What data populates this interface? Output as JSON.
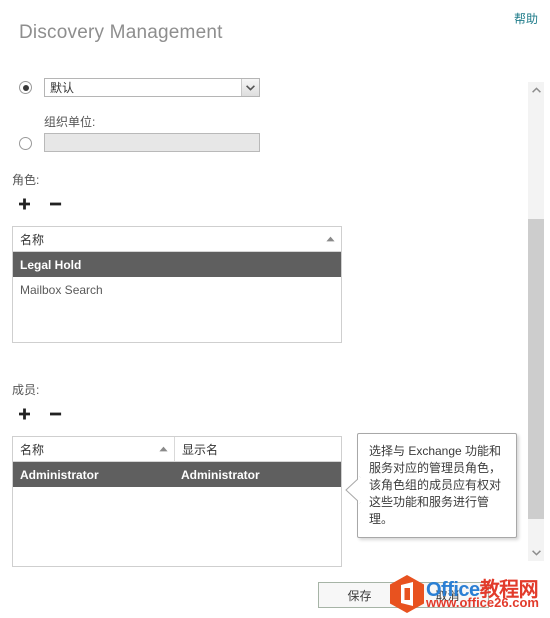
{
  "header": {
    "title": "Discovery Management",
    "help_label": "帮助",
    "help_color": "#1f7c8a"
  },
  "scope": {
    "default_radio_selected": true,
    "default_select_value": "默认",
    "default_select_options": [
      "默认"
    ],
    "ou_radio_selected": false,
    "ou_label": "组织单位:",
    "ou_input_value": "",
    "ou_input_placeholder": ""
  },
  "roles": {
    "section_label": "角色:",
    "add_label": "+",
    "remove_label": "−",
    "columns": [
      "名称"
    ],
    "sort_column": "名称",
    "sort_direction": "asc",
    "rows": [
      {
        "name": "Legal Hold",
        "selected": true
      },
      {
        "name": "Mailbox Search",
        "selected": false
      }
    ]
  },
  "members": {
    "section_label": "成员:",
    "add_label": "+",
    "remove_label": "−",
    "columns": [
      "名称",
      "显示名"
    ],
    "sort_column": "名称",
    "sort_direction": "asc",
    "rows": [
      {
        "name": "Administrator",
        "display_name": "Administrator",
        "selected": true
      }
    ]
  },
  "tooltip": {
    "text": "选择与 Exchange 功能和服务对应的管理员角色，该角色组的成员应有权对这些功能和服务进行管理。"
  },
  "footer": {
    "save_label": "保存",
    "cancel_label": "取消"
  },
  "watermark": {
    "brand_office": "Office",
    "brand_cn": "教程网",
    "url": "www.office26.com"
  },
  "scrollbar": {
    "up_icon": "chevron-up-icon",
    "down_icon": "chevron-down-icon"
  }
}
